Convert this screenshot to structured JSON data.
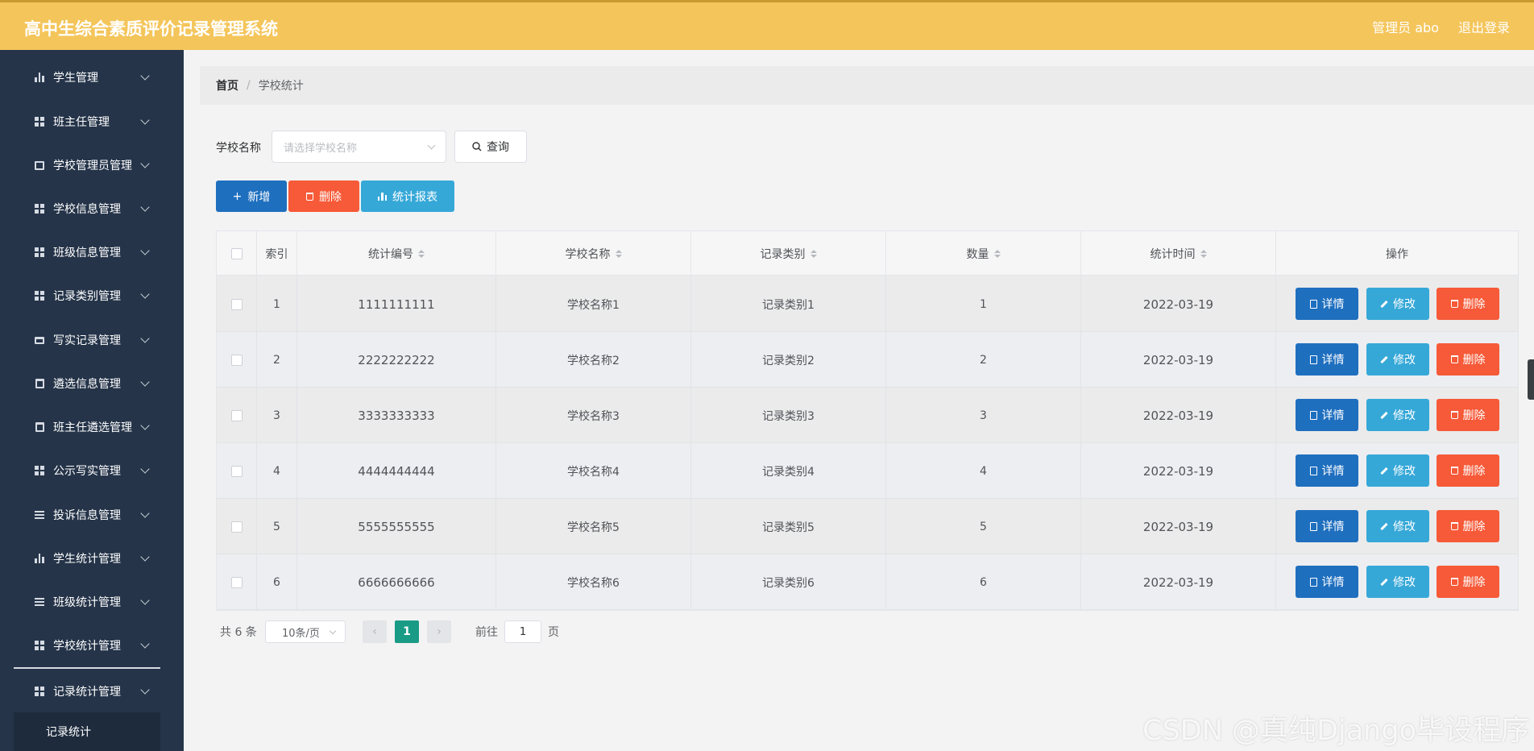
{
  "app": {
    "title": "高中生综合素质评价记录管理系统",
    "user": "管理员 abo",
    "logout": "退出登录"
  },
  "sidebar": {
    "items": [
      {
        "label": "学生管理",
        "icon": "bar-chart-icon"
      },
      {
        "label": "班主任管理",
        "icon": "grid-icon"
      },
      {
        "label": "学校管理员管理",
        "icon": "chart-icon"
      },
      {
        "label": "学校信息管理",
        "icon": "grid-icon"
      },
      {
        "label": "班级信息管理",
        "icon": "grid-icon"
      },
      {
        "label": "记录类别管理",
        "icon": "grid-icon"
      },
      {
        "label": "写实记录管理",
        "icon": "briefcase-icon"
      },
      {
        "label": "遴选信息管理",
        "icon": "clipboard-icon"
      },
      {
        "label": "班主任遴选管理",
        "icon": "clipboard-icon"
      },
      {
        "label": "公示写实管理",
        "icon": "grid-icon"
      },
      {
        "label": "投诉信息管理",
        "icon": "list-icon"
      },
      {
        "label": "学生统计管理",
        "icon": "bar-chart-icon"
      },
      {
        "label": "班级统计管理",
        "icon": "sliders-icon"
      },
      {
        "label": "学校统计管理",
        "icon": "grid-icon"
      },
      {
        "label": "记录统计管理",
        "icon": "grid-icon"
      }
    ],
    "submenu": "记录统计"
  },
  "breadcrumb": {
    "home": "首页",
    "separator": "/",
    "current": "学校统计"
  },
  "search": {
    "label": "学校名称",
    "placeholder": "请选择学校名称",
    "button": "查询"
  },
  "actions": {
    "add": "新增",
    "delete": "删除",
    "report": "统计报表"
  },
  "table": {
    "headers": {
      "index": "索引",
      "code": "统计编号",
      "school": "学校名称",
      "category": "记录类别",
      "count": "数量",
      "time": "统计时间",
      "ops": "操作"
    },
    "rows": [
      {
        "index": "1",
        "code": "1111111111",
        "school": "学校名称1",
        "category": "记录类别1",
        "count": "1",
        "time": "2022-03-19"
      },
      {
        "index": "2",
        "code": "2222222222",
        "school": "学校名称2",
        "category": "记录类别2",
        "count": "2",
        "time": "2022-03-19"
      },
      {
        "index": "3",
        "code": "3333333333",
        "school": "学校名称3",
        "category": "记录类别3",
        "count": "3",
        "time": "2022-03-19"
      },
      {
        "index": "4",
        "code": "4444444444",
        "school": "学校名称4",
        "category": "记录类别4",
        "count": "4",
        "time": "2022-03-19"
      },
      {
        "index": "5",
        "code": "5555555555",
        "school": "学校名称5",
        "category": "记录类别5",
        "count": "5",
        "time": "2022-03-19"
      },
      {
        "index": "6",
        "code": "6666666666",
        "school": "学校名称6",
        "category": "记录类别6",
        "count": "6",
        "time": "2022-03-19"
      }
    ],
    "row_buttons": {
      "detail": "详情",
      "edit": "修改",
      "delete": "删除"
    }
  },
  "pagination": {
    "total": "共 6 条",
    "page_size": "10条/页",
    "current_page": "1",
    "goto_label": "前往",
    "goto_value": "1",
    "page_suffix": "页"
  },
  "colors": {
    "header": "#f4c55a",
    "sidebar": "#253449",
    "primary": "#1f6fbf",
    "info": "#36a8d8",
    "danger": "#f65a38",
    "active_page": "#1a9b86"
  },
  "watermark": "CSDN @真纯Django毕设程序"
}
